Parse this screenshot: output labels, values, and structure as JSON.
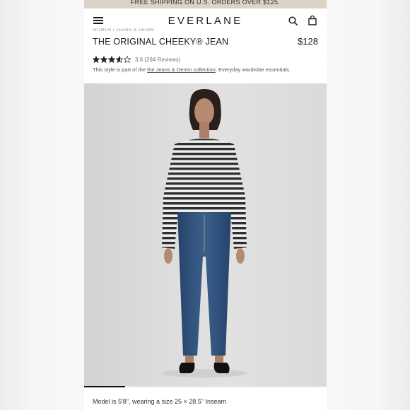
{
  "promo": {
    "text": "FREE SHIPPING ON U.S. ORDERS OVER $125."
  },
  "header": {
    "logo": "EVERLANE"
  },
  "breadcrumb": {
    "text": "WOMEN / JEANS & DENIM"
  },
  "product": {
    "title": "THE ORIGINAL CHEEKY® JEAN",
    "price": "$128",
    "rating": 3.6,
    "rating_text": "3.6 (294 Reviews)",
    "collection_note_prefix": "This style is part of the ",
    "collection_link": "the Jeans & Denim collection",
    "collection_note_suffix": ": Everyday wardrobe essentials."
  },
  "gallery": {
    "progress": 0.17
  },
  "caption": {
    "text": "Model is 5'8\", wearing a size 25 × 28.5\" Inseam"
  },
  "colors": {
    "promo_bg": "#dcd2c7",
    "photo_bg": "#dcdcdc",
    "sweater_stripe": "#2b2f3a",
    "denim": "#2f4f78"
  },
  "icons": [
    "menu-icon",
    "search-icon",
    "bag-icon",
    "star-icon"
  ]
}
